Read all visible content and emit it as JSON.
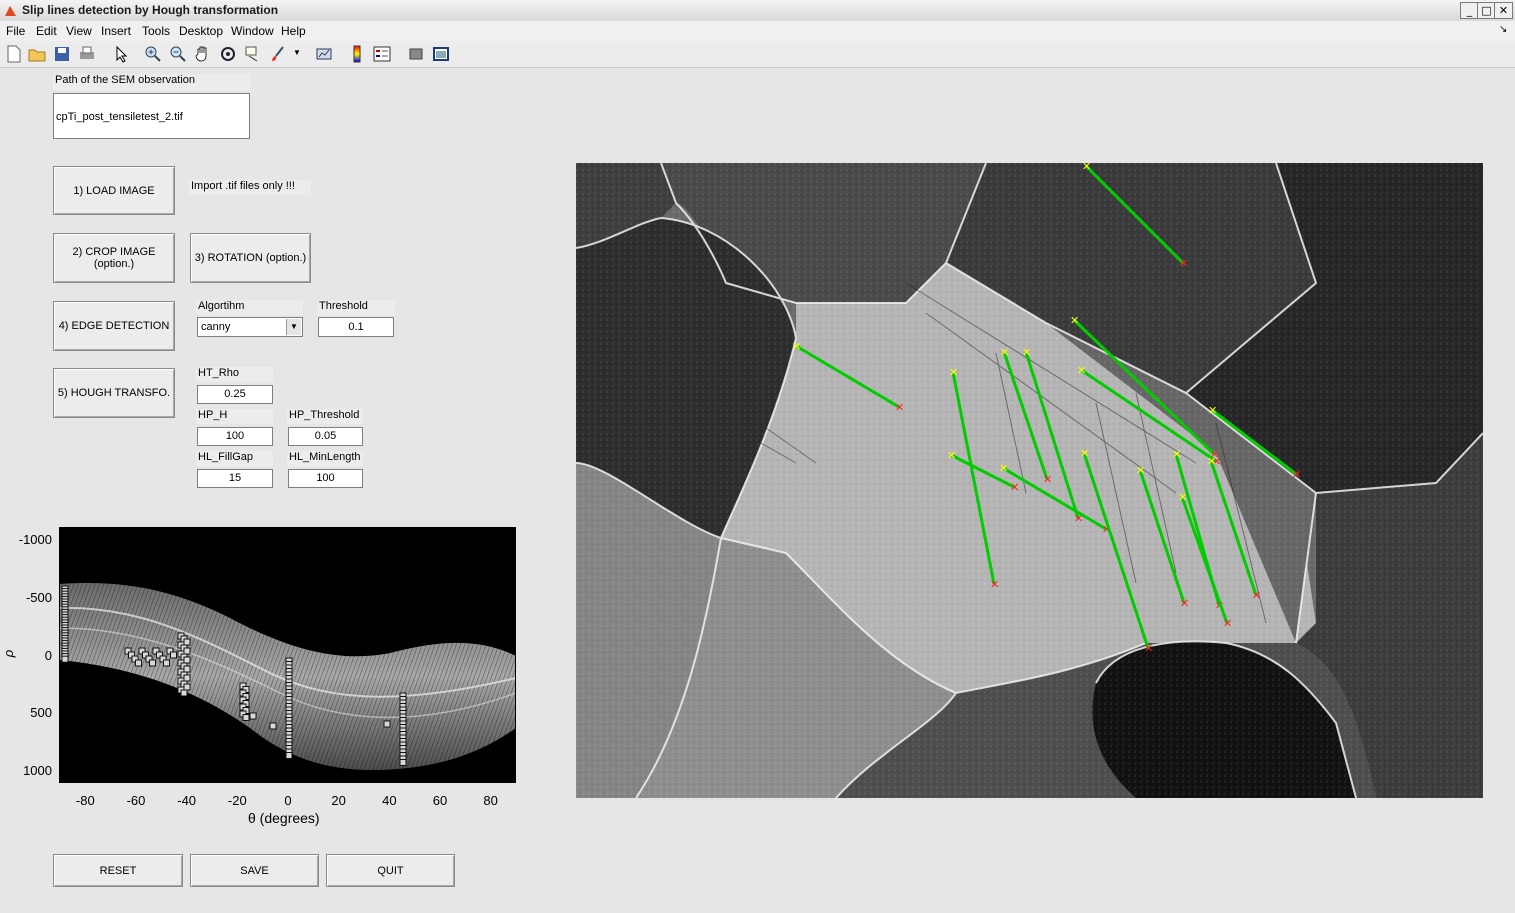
{
  "window": {
    "title": "Slip lines detection by Hough transformation",
    "controls": {
      "minimize": "_",
      "maximize": "□",
      "close": "✕"
    }
  },
  "menu": [
    "File",
    "Edit",
    "View",
    "Insert",
    "Tools",
    "Desktop",
    "Window",
    "Help"
  ],
  "toolbar_icons": [
    "new-figure-icon",
    "open-file-icon",
    "save-icon",
    "print-icon",
    "pointer-icon",
    "zoom-in-icon",
    "zoom-out-icon",
    "pan-icon",
    "rotate-3d-icon",
    "data-cursor-icon",
    "brush-icon",
    "link-plot-icon",
    "colorbar-icon",
    "legend-icon",
    "hide-plot-tools-icon",
    "show-plot-tools-icon"
  ],
  "path": {
    "label": "Path of the SEM observation",
    "value": "cpTi_post_tensiletest_2.tif"
  },
  "buttons": {
    "load": "1) LOAD IMAGE",
    "crop": "2) CROP IMAGE (option.)",
    "rotation": "3) ROTATION (option.)",
    "edge": "4) EDGE DETECTION",
    "hough": "5) HOUGH TRANSFO.",
    "reset": "RESET",
    "save": "SAVE",
    "quit": "QUIT"
  },
  "import_note": "Import .tif files only !!!",
  "edge": {
    "algorithm_label": "Algortihm",
    "algorithm_value": "canny",
    "threshold_label": "Threshold",
    "threshold_value": "0.1"
  },
  "hough": {
    "ht_rho_label": "HT_Rho",
    "ht_rho_value": "0.25",
    "hp_h_label": "HP_H",
    "hp_h_value": "100",
    "hp_threshold_label": "HP_Threshold",
    "hp_threshold_value": "0.05",
    "hl_fillgap_label": "HL_FillGap",
    "hl_fillgap_value": "15",
    "hl_minlength_label": "HL_MinLength",
    "hl_minlength_value": "100"
  },
  "colors": {
    "line": "#00cc00",
    "start_marker": "#ffff00",
    "end_marker": "#ff2020"
  },
  "chart_data": {
    "type": "heatmap",
    "xlabel": "θ (degrees)",
    "ylabel": "ρ",
    "xlim": [
      -90,
      90
    ],
    "ylim": [
      -1100,
      1100
    ],
    "y_reversed": true,
    "xticks": [
      -80,
      -60,
      -40,
      -20,
      0,
      20,
      40,
      60,
      80
    ],
    "yticks": [
      -1000,
      -500,
      0,
      500,
      1000
    ],
    "xtick_labels": [
      "-80",
      "-60",
      "-40",
      "-20",
      "0",
      "20",
      "40",
      "60",
      "80"
    ],
    "ytick_labels": [
      "-1000",
      "-500",
      "0",
      "500",
      "1000"
    ]
  }
}
